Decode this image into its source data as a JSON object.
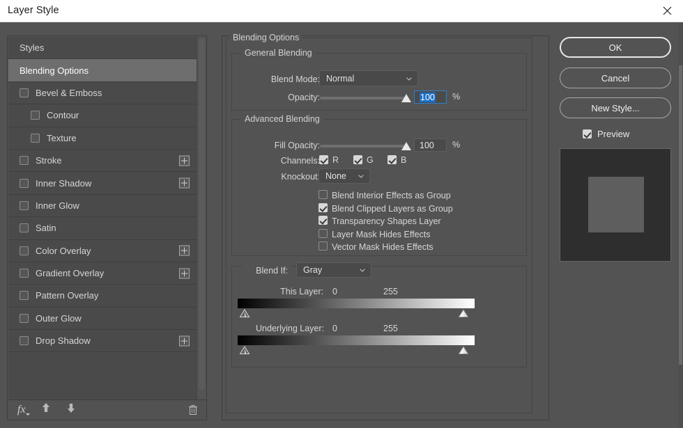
{
  "window": {
    "title": "Layer Style",
    "close_icon": "close-icon"
  },
  "sidebar": {
    "toolbar": {
      "fx_label": "fx",
      "up_icon": "arrow-up-icon",
      "down_icon": "arrow-down-icon",
      "trash_icon": "trash-icon"
    },
    "items": [
      {
        "label": "Styles",
        "type": "header",
        "selected": false,
        "checkbox": null,
        "plus": false,
        "indent": false
      },
      {
        "label": "Blending Options",
        "type": "header",
        "selected": true,
        "checkbox": null,
        "plus": false,
        "indent": false
      },
      {
        "label": "Bevel & Emboss",
        "type": "effect",
        "selected": false,
        "checkbox": false,
        "plus": false,
        "indent": false
      },
      {
        "label": "Contour",
        "type": "effect",
        "selected": false,
        "checkbox": false,
        "plus": false,
        "indent": true
      },
      {
        "label": "Texture",
        "type": "effect",
        "selected": false,
        "checkbox": false,
        "plus": false,
        "indent": true
      },
      {
        "label": "Stroke",
        "type": "effect",
        "selected": false,
        "checkbox": false,
        "plus": true,
        "indent": false
      },
      {
        "label": "Inner Shadow",
        "type": "effect",
        "selected": false,
        "checkbox": false,
        "plus": true,
        "indent": false
      },
      {
        "label": "Inner Glow",
        "type": "effect",
        "selected": false,
        "checkbox": false,
        "plus": false,
        "indent": false
      },
      {
        "label": "Satin",
        "type": "effect",
        "selected": false,
        "checkbox": false,
        "plus": false,
        "indent": false
      },
      {
        "label": "Color Overlay",
        "type": "effect",
        "selected": false,
        "checkbox": false,
        "plus": true,
        "indent": false
      },
      {
        "label": "Gradient Overlay",
        "type": "effect",
        "selected": false,
        "checkbox": false,
        "plus": true,
        "indent": false
      },
      {
        "label": "Pattern Overlay",
        "type": "effect",
        "selected": false,
        "checkbox": false,
        "plus": false,
        "indent": false
      },
      {
        "label": "Outer Glow",
        "type": "effect",
        "selected": false,
        "checkbox": false,
        "plus": false,
        "indent": false
      },
      {
        "label": "Drop Shadow",
        "type": "effect",
        "selected": false,
        "checkbox": false,
        "plus": true,
        "indent": false
      }
    ]
  },
  "main": {
    "section_title": "Blending Options",
    "general_blending": {
      "legend": "General Blending",
      "blend_mode_label": "Blend Mode:",
      "blend_mode_value": "Normal",
      "opacity_label": "Opacity:",
      "opacity_value": "100",
      "opacity_unit": "%",
      "opacity_percent": 100
    },
    "advanced_blending": {
      "legend": "Advanced Blending",
      "fill_opacity_label": "Fill Opacity:",
      "fill_opacity_value": "100",
      "fill_opacity_unit": "%",
      "fill_opacity_percent": 100,
      "channels_label": "Channels:",
      "channels": [
        {
          "label": "R",
          "checked": true
        },
        {
          "label": "G",
          "checked": true
        },
        {
          "label": "B",
          "checked": true
        }
      ],
      "knockout_label": "Knockout:",
      "knockout_value": "None",
      "options": [
        {
          "label": "Blend Interior Effects as Group",
          "checked": false
        },
        {
          "label": "Blend Clipped Layers as Group",
          "checked": true
        },
        {
          "label": "Transparency Shapes Layer",
          "checked": true
        },
        {
          "label": "Layer Mask Hides Effects",
          "checked": false
        },
        {
          "label": "Vector Mask Hides Effects",
          "checked": false
        }
      ]
    },
    "blend_if": {
      "legend": "Blend If:",
      "channel_value": "Gray",
      "this_layer_label": "This Layer:",
      "this_layer_min": "0",
      "this_layer_max": "255",
      "underlying_layer_label": "Underlying Layer:",
      "underlying_layer_min": "0",
      "underlying_layer_max": "255"
    }
  },
  "buttons": {
    "ok": "OK",
    "cancel": "Cancel",
    "new_style": "New Style...",
    "preview_label": "Preview",
    "preview_checked": true
  },
  "colors": {
    "dialog_bg": "#535353",
    "list_bg": "#4a4a4a",
    "selected_row": "#6e6e6e",
    "accent_blue": "#1c6ec4",
    "focus_border": "#2f7fd1",
    "text": "#d6d6d6",
    "title_bar": "#ffffff"
  }
}
